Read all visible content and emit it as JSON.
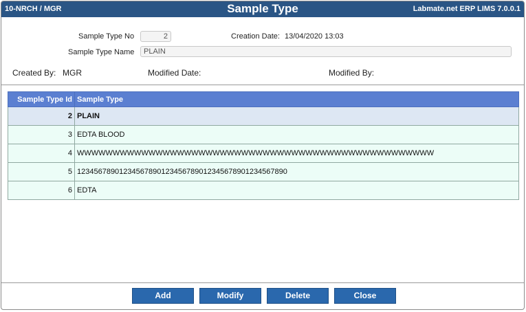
{
  "titlebar": {
    "left": "10-NRCH / MGR",
    "title": "Sample Type",
    "right": "Labmate.net ERP LIMS 7.0.0.1"
  },
  "form": {
    "sample_type_no_label": "Sample Type No",
    "sample_type_no_value": "2",
    "creation_date_label": "Creation Date:",
    "creation_date_value": "13/04/2020 13:03",
    "sample_type_name_label": "Sample Type Name",
    "sample_type_name_value": "PLAIN",
    "created_by_label": "Created By:",
    "created_by_value": "MGR",
    "modified_date_label": "Modified Date:",
    "modified_date_value": "",
    "modified_by_label": "Modified By:",
    "modified_by_value": ""
  },
  "grid": {
    "columns": [
      "Sample Type Id",
      "Sample Type"
    ],
    "rows": [
      {
        "id": "2",
        "type": "PLAIN",
        "selected": true
      },
      {
        "id": "3",
        "type": "EDTA BLOOD"
      },
      {
        "id": "4",
        "type": "WWWWWWWWWWWWWWWWWWWWWWWWWWWWWWWWWWWWWWWWWWWWWWWWWW"
      },
      {
        "id": "5",
        "type": "12345678901234567890123456789012345678901234567890"
      },
      {
        "id": "6",
        "type": "EDTA"
      }
    ]
  },
  "buttons": {
    "add": "Add",
    "modify": "Modify",
    "delete": "Delete",
    "close": "Close"
  },
  "colors": {
    "titlebar": "#2a5585",
    "grid_header": "#5b7fd1",
    "row_background": "#ecfdf7",
    "selected_row": "#dde7f3",
    "button": "#2a68ad"
  }
}
